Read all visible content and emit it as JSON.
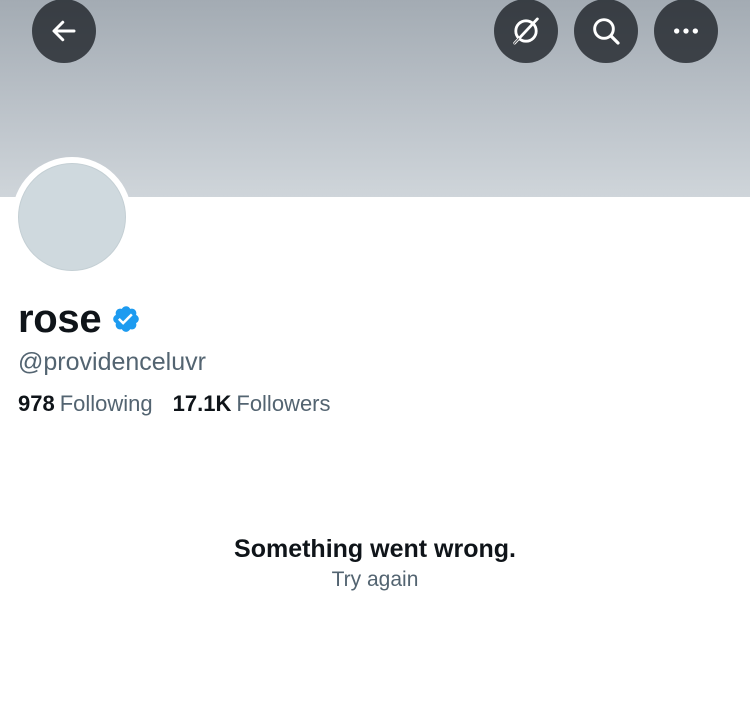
{
  "header": {
    "back_icon": "arrow-left-icon",
    "grok_icon": "grok-icon",
    "search_icon": "search-icon",
    "more_icon": "more-horizontal-icon"
  },
  "profile": {
    "display_name": "rose",
    "verified": true,
    "verified_color": "#1d9bf0",
    "handle": "@providenceluvr",
    "following_count": "978",
    "following_label": "Following",
    "followers_count": "17.1K",
    "followers_label": "Followers"
  },
  "error": {
    "title": "Something went wrong.",
    "retry_label": "Try again"
  }
}
